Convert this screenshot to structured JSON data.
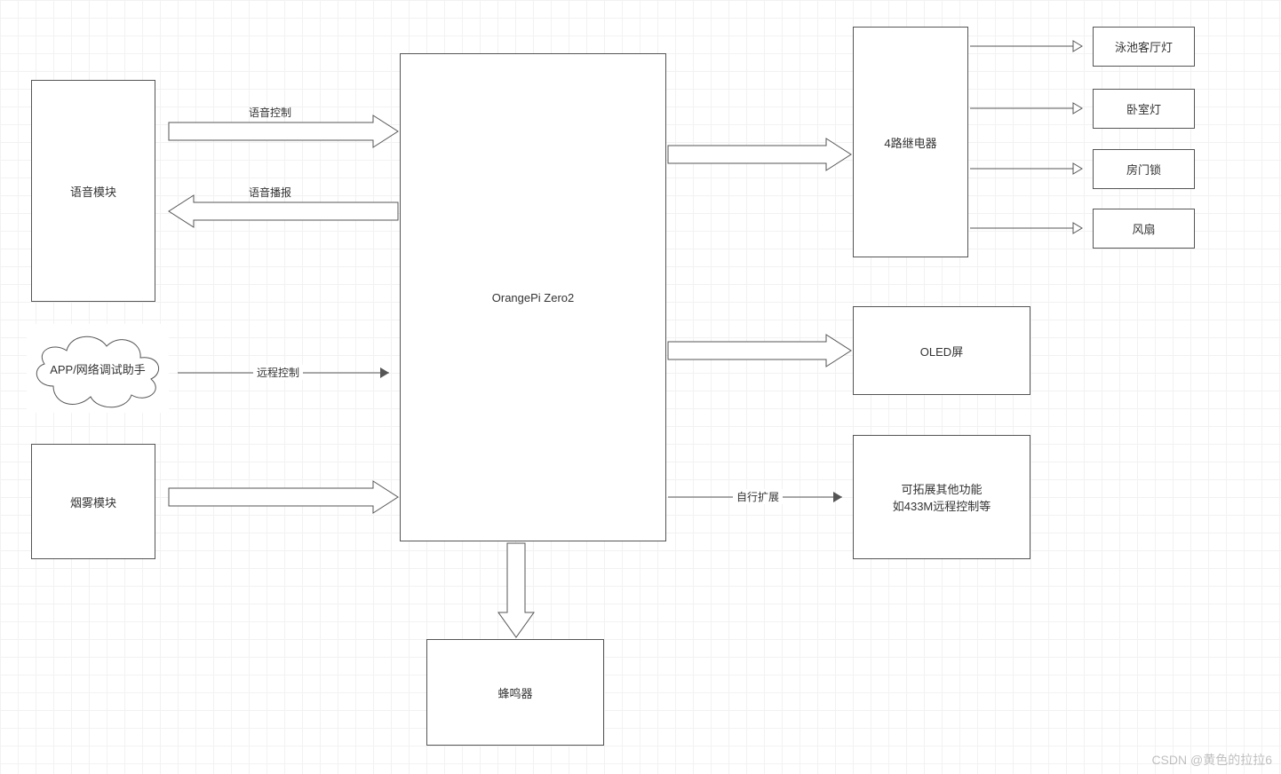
{
  "nodes": {
    "voice_module": "语音模块",
    "app_network": "APP/网络调试助手",
    "smoke_module": "烟雾模块",
    "central": "OrangePi Zero2",
    "buzzer": "蜂鸣器",
    "relay": "4路继电器",
    "oled": "OLED屏",
    "expand_line1": "可拓展其他功能",
    "expand_line2": "如433M远程控制等",
    "out1": "泳池客厅灯",
    "out2": "卧室灯",
    "out3": "房门锁",
    "out4": "风扇"
  },
  "labels": {
    "voice_control": "语音控制",
    "voice_broadcast": "语音播报",
    "remote_control": "远程控制",
    "self_expand": "自行扩展"
  },
  "watermark": "CSDN @黄色的拉拉6"
}
